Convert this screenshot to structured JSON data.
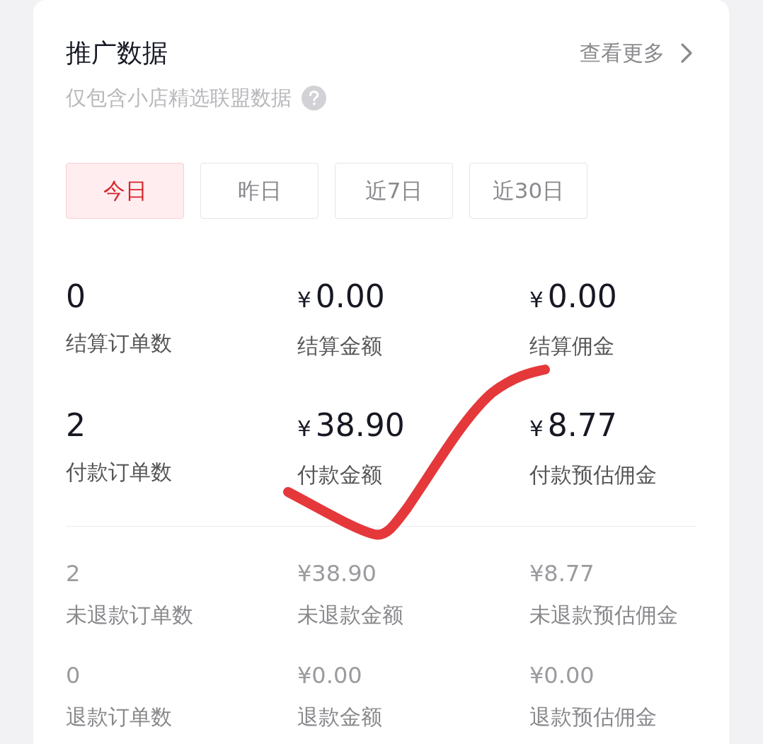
{
  "header": {
    "title": "推广数据",
    "more_link": "查看更多",
    "subtitle": "仅包含小店精选联盟数据"
  },
  "tabs": [
    {
      "label": "今日",
      "selected": true
    },
    {
      "label": "昨日",
      "selected": false
    },
    {
      "label": "近7日",
      "selected": false
    },
    {
      "label": "近30日",
      "selected": false
    }
  ],
  "primary_stats": [
    {
      "value": "0",
      "label": "结算订单数"
    },
    {
      "currency": "¥",
      "value": "0.00",
      "label": "结算金额"
    },
    {
      "currency": "¥",
      "value": "0.00",
      "label": "结算佣金"
    },
    {
      "value": "2",
      "label": "付款订单数"
    },
    {
      "currency": "¥",
      "value": "38.90",
      "label": "付款金额"
    },
    {
      "currency": "¥",
      "value": "8.77",
      "label": "付款预估佣金"
    }
  ],
  "secondary_stats": [
    {
      "value": "2",
      "label": "未退款订单数"
    },
    {
      "value": "¥38.90",
      "label": "未退款金额"
    },
    {
      "value": "¥8.77",
      "label": "未退款预估佣金"
    },
    {
      "value": "0",
      "label": "退款订单数"
    },
    {
      "value": "¥0.00",
      "label": "退款金额"
    },
    {
      "value": "¥0.00",
      "label": "退款预估佣金"
    }
  ],
  "annotations": [
    {
      "kind": "checkmark"
    }
  ]
}
